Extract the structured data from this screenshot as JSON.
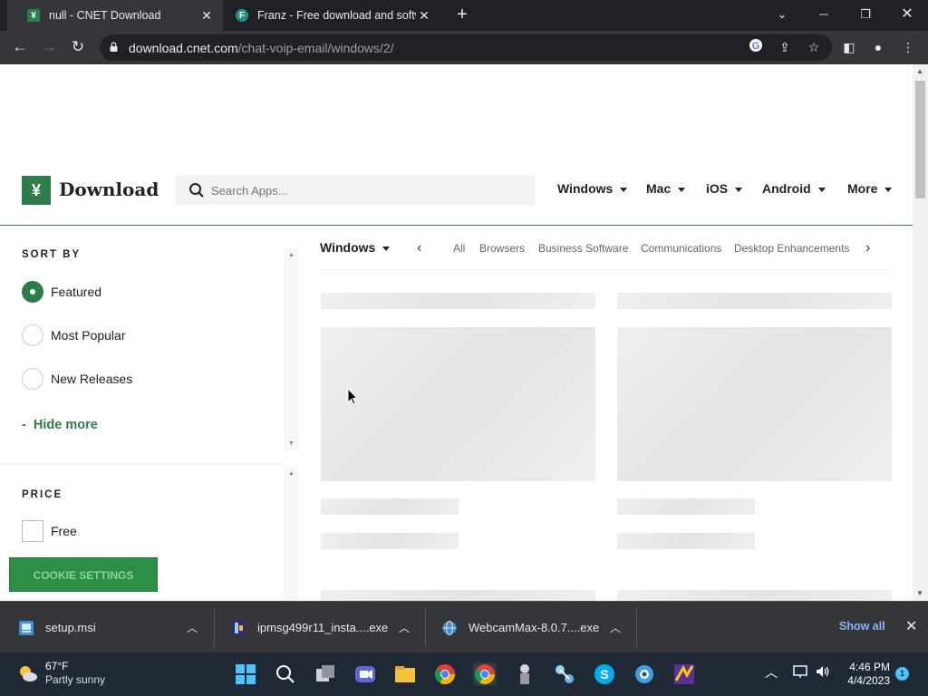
{
  "browser": {
    "tabs": [
      {
        "title": "null - CNET Download",
        "active": true,
        "favicon": "cnet-download-icon"
      },
      {
        "title": "Franz - Free download and softw",
        "active": false,
        "favicon": "franz-icon"
      }
    ],
    "url_host": "download.cnet.com",
    "url_path": "/chat-voip-email/windows/2/"
  },
  "header": {
    "logo_text": "Download",
    "search_placeholder": "Search Apps...",
    "nav": [
      {
        "label": "Windows"
      },
      {
        "label": "Mac"
      },
      {
        "label": "iOS"
      },
      {
        "label": "Android"
      },
      {
        "label": "More"
      }
    ]
  },
  "sidebar": {
    "sort_label": "SORT BY",
    "sort_options": [
      {
        "label": "Featured",
        "checked": true
      },
      {
        "label": "Most Popular",
        "checked": false
      },
      {
        "label": "New Releases",
        "checked": false
      }
    ],
    "hide_more": "Hide more",
    "hide_more_prefix": "-",
    "price_label": "PRICE",
    "price_options": [
      {
        "label": "Free",
        "checked": false
      }
    ]
  },
  "cookie_button": "COOKIE SETTINGS",
  "category_bar": {
    "platform": "Windows",
    "categories": [
      "All",
      "Browsers",
      "Business Software",
      "Communications",
      "Desktop Enhancements"
    ]
  },
  "downloads": {
    "items": [
      {
        "name": "setup.msi",
        "icon": "msi-installer-icon"
      },
      {
        "name": "ipmsg499r11_insta....exe",
        "icon": "exe-installer-icon"
      },
      {
        "name": "WebcamMax-8.0.7....exe",
        "icon": "globe-exe-icon"
      }
    ],
    "show_all": "Show all"
  },
  "taskbar": {
    "weather_temp": "67°F",
    "weather_cond": "Partly sunny",
    "time": "4:46 PM",
    "date": "4/4/2023",
    "notification_count": "1"
  },
  "colors": {
    "brand_green": "#2d7d4a",
    "chrome_dark": "#202124",
    "chrome_toolbar": "#35363a",
    "taskbar": "#1f2a36"
  }
}
